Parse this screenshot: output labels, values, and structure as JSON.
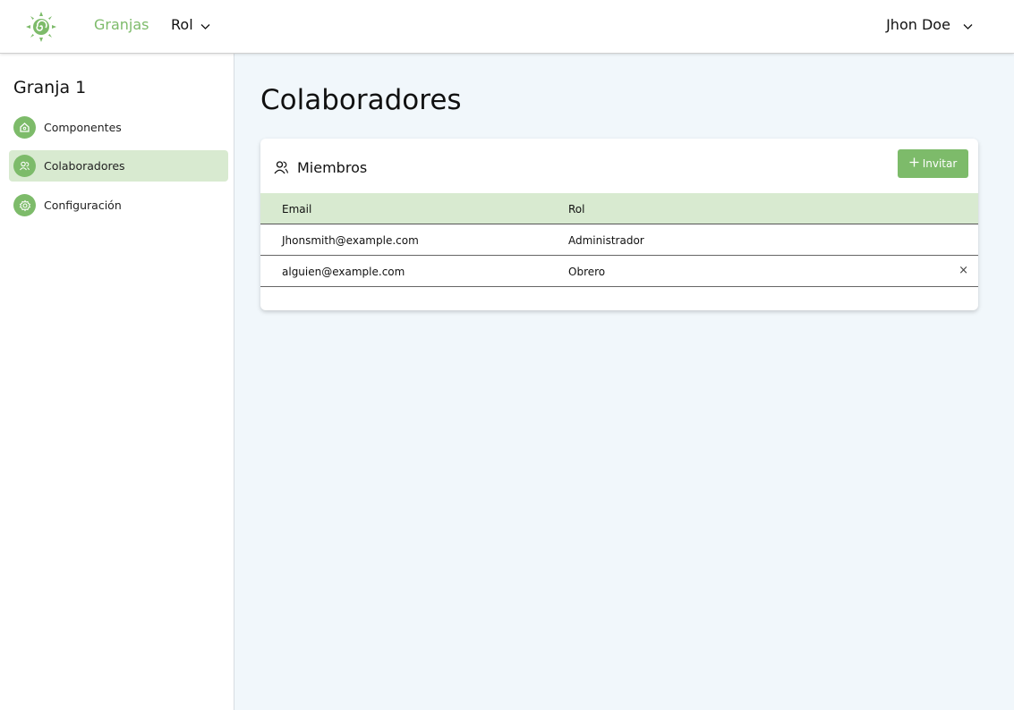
{
  "colors": {
    "accent": "#7dbb6a",
    "active_bg": "#d8ead0",
    "main_bg": "#f1f7fb"
  },
  "header": {
    "logo_icon": "sun-spiral-icon",
    "nav_farms": "Granjas",
    "nav_role": "Rol",
    "user_name": "Jhon Doe"
  },
  "sidebar": {
    "farm_title": "Granja 1",
    "items": [
      {
        "label": "Componentes",
        "icon": "home-icon",
        "active": false
      },
      {
        "label": "Colaboradores",
        "icon": "users-icon",
        "active": true
      },
      {
        "label": "Configuración",
        "icon": "gear-icon",
        "active": false
      }
    ]
  },
  "main": {
    "page_title": "Colaboradores",
    "card": {
      "title": "Miembros",
      "invite_label": "Invitar",
      "columns": [
        "Email",
        "Rol"
      ],
      "rows": [
        {
          "email": "Jhonsmith@example.com",
          "role": "Administrador",
          "removable": false
        },
        {
          "email": "alguien@example.com",
          "role": "Obrero",
          "removable": true,
          "remove_symbol": "×"
        }
      ]
    }
  }
}
